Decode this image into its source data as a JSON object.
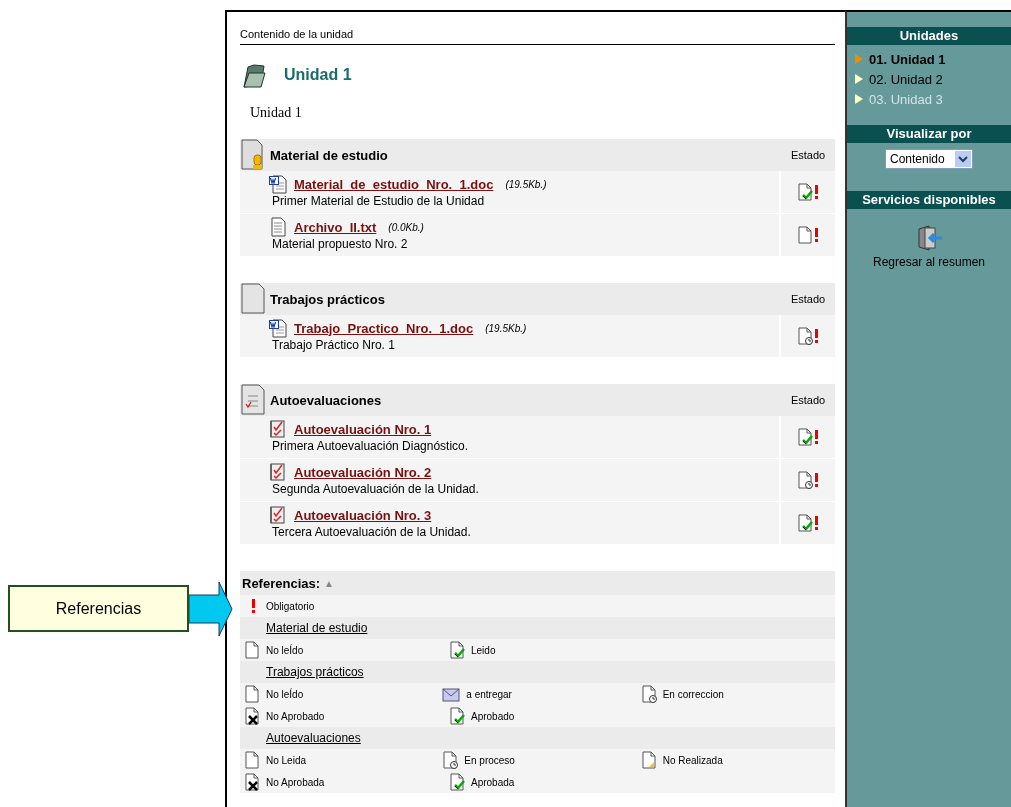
{
  "header": "Contenido de la unidad",
  "unit": {
    "title": "Unidad 1",
    "description": "Unidad 1"
  },
  "sections": [
    {
      "kind": "material",
      "title": "Material de estudio",
      "status_heading": "Estado",
      "items": [
        {
          "kind": "doc",
          "name": "Material_de_estudio_Nro._1.doc",
          "size": "(19.5Kb.)",
          "description": "Primer Material de Estudio de la Unidad",
          "status": {
            "kind": "read",
            "required": true
          }
        },
        {
          "kind": "txt",
          "name": "Archivo_II.txt",
          "size": "(0.0Kb.)",
          "description": "Material propuesto Nro. 2",
          "status": {
            "kind": "unread",
            "required": true
          }
        }
      ]
    },
    {
      "kind": "practice",
      "title": "Trabajos prácticos",
      "status_heading": "Estado",
      "items": [
        {
          "kind": "doc",
          "name": "Trabajo_Practico_Nro._1.doc",
          "size": "(19.5Kb.)",
          "description": "Trabajo Práctico Nro. 1",
          "status": {
            "kind": "review",
            "required": true
          }
        }
      ]
    },
    {
      "kind": "quiz",
      "title": "Autoevaluaciones",
      "status_heading": "Estado",
      "items": [
        {
          "kind": "quiz",
          "name": "Autoevaluación Nro. 1",
          "description": "Primera Autoevaluación Diagnóstico.",
          "status": {
            "kind": "read",
            "required": true
          }
        },
        {
          "kind": "quiz",
          "name": "Autoevaluación Nro. 2",
          "description": "Segunda Autoevaluación de la Unidad.",
          "status": {
            "kind": "review",
            "required": true
          }
        },
        {
          "kind": "quiz",
          "name": "Autoevaluación Nro. 3",
          "description": "Tercera Autoevaluación de la Unidad.",
          "status": {
            "kind": "read",
            "required": true
          }
        }
      ]
    }
  ],
  "references": {
    "title": "Referencias:",
    "toggle": "▲",
    "required_label": "Obligatorio",
    "groups": [
      {
        "title": "Material de estudio",
        "entries": [
          {
            "kind": "unread",
            "label": "No leÍdo"
          },
          {
            "kind": "read",
            "label": "Leido"
          }
        ]
      },
      {
        "title": "Trabajos prácticos",
        "entries": [
          {
            "kind": "unread",
            "label": "No leÍdo"
          },
          {
            "kind": "mail",
            "label": "a entregar"
          },
          {
            "kind": "review",
            "label": "En correccion"
          },
          {
            "kind": "failed",
            "label": "No Aprobado"
          },
          {
            "kind": "read",
            "label": "Aprobado"
          }
        ]
      },
      {
        "title": "Autoevaluaciones",
        "entries": [
          {
            "kind": "unread",
            "label": "No Leida"
          },
          {
            "kind": "review",
            "label": "En proceso"
          },
          {
            "kind": "pending",
            "label": "No Realizada"
          },
          {
            "kind": "failed",
            "label": "No Aprobada"
          },
          {
            "kind": "read",
            "label": "Aprobada"
          }
        ]
      }
    ]
  },
  "sidebar": {
    "units_heading": "Unidades",
    "units": [
      {
        "label": "01. Unidad 1",
        "selected": true,
        "disabled": false
      },
      {
        "label": "02. Unidad 2",
        "selected": false,
        "disabled": false
      },
      {
        "label": "03. Unidad 3",
        "selected": false,
        "disabled": true
      }
    ],
    "view_heading": "Visualizar por",
    "view_value": "Contenido",
    "services_heading": "Servicios disponibles",
    "services": [
      {
        "label": "Regresar al resumen"
      }
    ]
  },
  "callout": {
    "label": "Referencias"
  }
}
